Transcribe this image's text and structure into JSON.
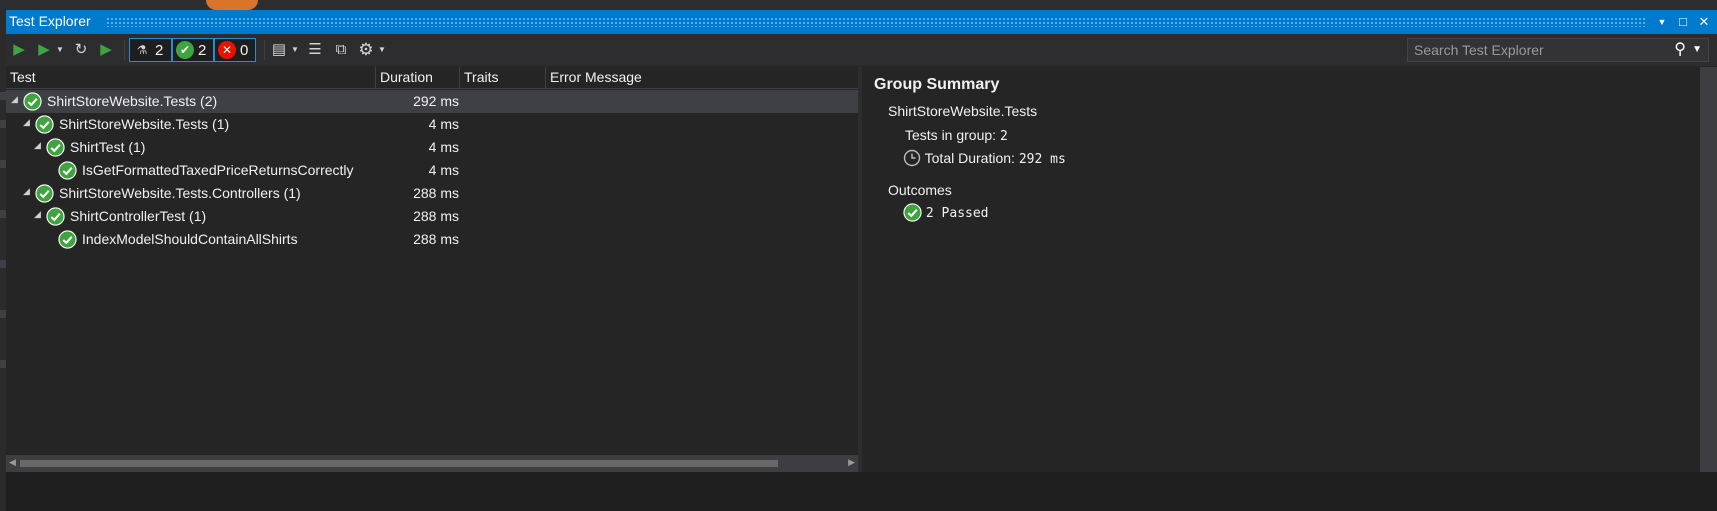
{
  "window": {
    "title": "Test Explorer"
  },
  "toolbar": {
    "counts": {
      "total": "2",
      "passed": "2",
      "failed": "0"
    },
    "search_placeholder": "Search Test Explorer"
  },
  "columns": [
    "Test",
    "Duration",
    "Traits",
    "Error Message"
  ],
  "tests": [
    {
      "name": "ShirtStoreWebsite.Tests",
      "count": "(2)",
      "duration": "292 ms",
      "expanded": true,
      "selected": true
    },
    {
      "name": "ShirtStoreWebsite.Tests",
      "count": "(1)",
      "duration": "4 ms",
      "expanded": true
    },
    {
      "name": "ShirtTest",
      "count": "(1)",
      "duration": "4 ms",
      "expanded": true
    },
    {
      "name": "IsGetFormattedTaxedPriceReturnsCorrectly",
      "count": "",
      "duration": "4 ms",
      "expanded": false
    },
    {
      "name": "ShirtStoreWebsite.Tests.Controllers",
      "count": "(1)",
      "duration": "288 ms",
      "expanded": true
    },
    {
      "name": "ShirtControllerTest",
      "count": "(1)",
      "duration": "288 ms",
      "expanded": true
    },
    {
      "name": "IndexModelShouldContainAllShirts",
      "count": "",
      "duration": "288 ms",
      "expanded": false
    }
  ],
  "summary": {
    "title": "Group Summary",
    "group_name": "ShirtStoreWebsite.Tests",
    "tests_in_group_label": "Tests in group:",
    "tests_in_group_value": "2",
    "total_duration_label": "Total Duration:",
    "total_duration_value": "292 ms",
    "outcomes_label": "Outcomes",
    "passed_label": "2 Passed"
  },
  "colors": {
    "accent": "#007acc",
    "pass": "#3fa33f",
    "fail": "#e51400",
    "background": "#252526"
  },
  "icons": [
    "run-all-icon",
    "run-icon",
    "refresh-icon",
    "cancel-icon",
    "flask-icon",
    "passed-icon",
    "failed-icon",
    "playlist-icon",
    "group-by-icon",
    "expand-icon",
    "settings-icon",
    "search-icon",
    "clock-icon"
  ]
}
